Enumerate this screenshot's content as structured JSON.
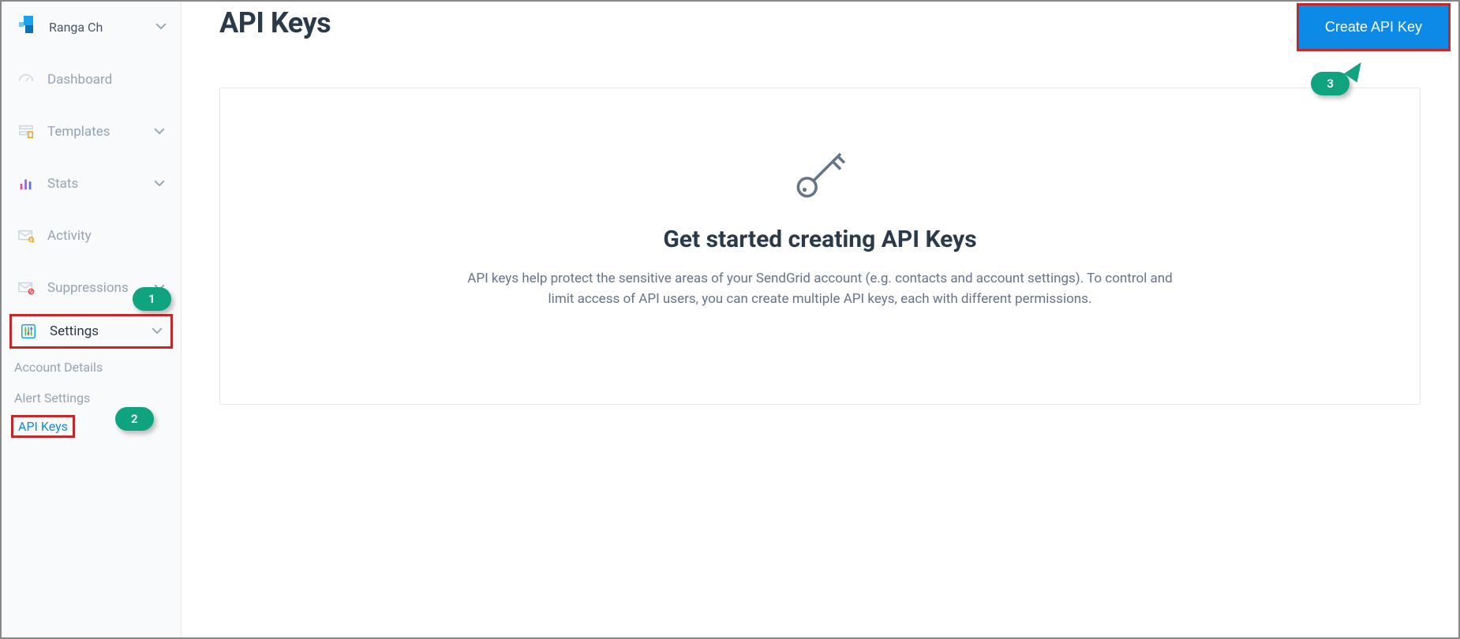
{
  "user": {
    "name": "Ranga Ch"
  },
  "sidebar": {
    "items": {
      "dashboard": "Dashboard",
      "templates": "Templates",
      "stats": "Stats",
      "activity": "Activity",
      "suppressions": "Suppressions",
      "settings": "Settings"
    },
    "sub": {
      "account_details": "Account Details",
      "alert_settings": "Alert Settings",
      "api_keys": "API Keys"
    }
  },
  "page": {
    "title": "API Keys",
    "create_button": "Create API Key",
    "empty": {
      "heading": "Get started creating API Keys",
      "body": "API keys help protect the sensitive areas of your SendGrid account (e.g. contacts and account settings). To control and limit access of API users, you can create multiple API keys, each with different permissions."
    }
  },
  "annotations": {
    "one": "1",
    "two": "2",
    "three": "3"
  }
}
